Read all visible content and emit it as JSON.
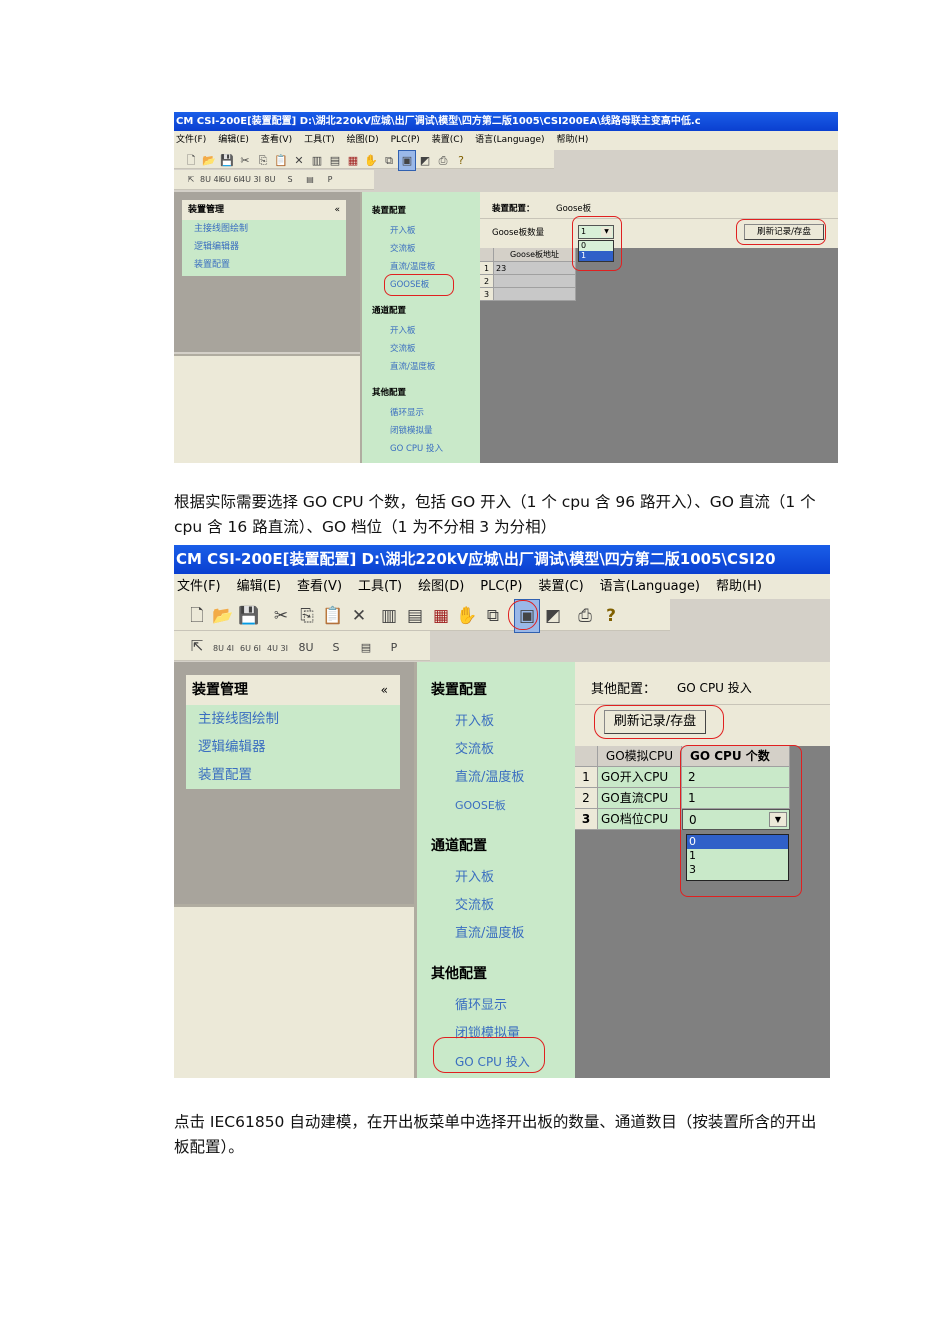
{
  "shot1": {
    "title": "CM CSI-200E[装置配置]  D:\\湖北220kV应城\\出厂调试\\模型\\四方第二版1005\\CSI200EA\\线路母联主变高中低.c",
    "menu": [
      "文件(F)",
      "编辑(E)",
      "查看(V)",
      "工具(T)",
      "绘图(D)",
      "PLC(P)",
      "装置(C)",
      "语言(Language)",
      "帮助(H)"
    ],
    "toolbar2": [
      "8U 4I",
      "6U 6I",
      "4U 3I",
      "8U",
      "S",
      "▤",
      "P"
    ],
    "left_header": "装置管理",
    "left_items": [
      "主接线图绘制",
      "逻辑编辑器",
      "装置配置"
    ],
    "nav": [
      {
        "header": "装置配置",
        "items": [
          "开入板",
          "交流板",
          "直流/温度板",
          "GOOSE板"
        ]
      },
      {
        "header": "通道配置",
        "items": [
          "开入板",
          "交流板",
          "直流/温度板"
        ]
      },
      {
        "header": "其他配置",
        "items": [
          "循环显示",
          "闭锁模拟量",
          "GO CPU 投入"
        ]
      }
    ],
    "config_label": "装置配置：",
    "config_value": "Goose板",
    "count_label": "Goose板数量",
    "count_value": "1",
    "dropdown_options": [
      "0",
      "1"
    ],
    "refresh_button": "刷新记录/存盘",
    "grid_header": "Goose板地址",
    "rows": [
      {
        "n": "1",
        "v": "23"
      },
      {
        "n": "2",
        "v": ""
      },
      {
        "n": "3",
        "v": ""
      }
    ]
  },
  "para1": "根据实际需要选择 GO  CPU 个数，包括 GO 开入（1 个 cpu 含 96 路开入）、GO 直流（1 个 cpu 含 16 路直流）、GO 档位（1 为不分相 3 为分相）",
  "shot2": {
    "title": "CM CSI-200E[装置配置]   D:\\湖北220kV应城\\出厂调试\\模型\\四方第二版1005\\CSI20",
    "menu": [
      "文件(F)",
      "编辑(E)",
      "查看(V)",
      "工具(T)",
      "绘图(D)",
      "PLC(P)",
      "装置(C)",
      "语言(Language)",
      "帮助(H)"
    ],
    "toolbar2": [
      "8U 4I",
      "6U 6I",
      "4U 3I",
      "8U",
      "S",
      "▤",
      "P"
    ],
    "left_header": "装置管理",
    "left_items": [
      "主接线图绘制",
      "逻辑编辑器",
      "装置配置"
    ],
    "nav": [
      {
        "header": "装置配置",
        "items": [
          "开入板",
          "交流板",
          "直流/温度板",
          "GOOSE板"
        ]
      },
      {
        "header": "通道配置",
        "items": [
          "开入板",
          "交流板",
          "直流/温度板"
        ]
      },
      {
        "header": "其他配置",
        "items": [
          "循环显示",
          "闭锁模拟量",
          "GO CPU 投入"
        ]
      }
    ],
    "config_label": "其他配置：",
    "config_value": "GO CPU 投入",
    "refresh_button": "刷新记录/存盘",
    "grid_headers": [
      "GO模拟CPU",
      "GO CPU 个数"
    ],
    "rows": [
      {
        "n": "1",
        "name": "GO开入CPU",
        "v": "2"
      },
      {
        "n": "2",
        "name": "GO直流CPU",
        "v": "1"
      },
      {
        "n": "3",
        "name": "GO档位CPU",
        "v": "0"
      }
    ],
    "dropdown_options": [
      "0",
      "1",
      "3"
    ]
  },
  "para2": "点击 IEC61850  自动建模，在开出板菜单中选择开出板的数量、通道数目（按装置所含的开出板配置）。"
}
